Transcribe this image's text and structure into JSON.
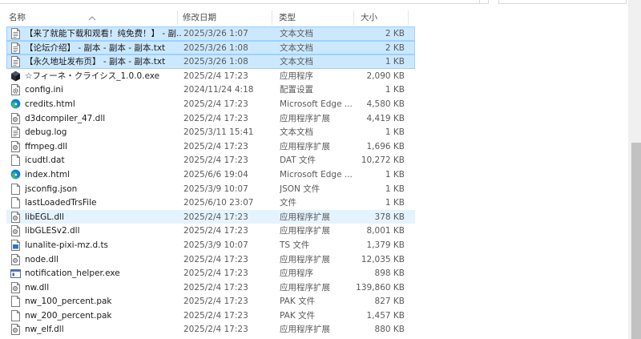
{
  "columns": {
    "name": "名称",
    "date": "修改日期",
    "type": "类型",
    "size": "大小"
  },
  "files": [
    {
      "name": "【来了就能下载和观看！纯免费！】 - 副...",
      "date": "2025/3/26 1:07",
      "type": "文本文档",
      "size": "2 KB",
      "icon": "text-file-icon",
      "state": "selected"
    },
    {
      "name": "【论坛介绍】 - 副本 - 副本 - 副本.txt",
      "date": "2025/3/26 1:08",
      "type": "文本文档",
      "size": "2 KB",
      "icon": "text-file-icon",
      "state": "selected"
    },
    {
      "name": "【永久地址发布页】 - 副本 - 副本.txt",
      "date": "2025/3/26 1:08",
      "type": "文本文档",
      "size": "1 KB",
      "icon": "text-file-icon",
      "state": "selected"
    },
    {
      "name": "☆フィーネ・クライシス_1.0.0.exe",
      "date": "2025/2/4 17:23",
      "type": "应用程序",
      "size": "2,090 KB",
      "icon": "app-exe-icon",
      "state": ""
    },
    {
      "name": "config.ini",
      "date": "2024/11/24 4:18",
      "type": "配置设置",
      "size": "1 KB",
      "icon": "config-file-icon",
      "state": ""
    },
    {
      "name": "credits.html",
      "date": "2025/2/4 17:23",
      "type": "Microsoft Edge ...",
      "size": "4,580 KB",
      "icon": "edge-html-icon",
      "state": ""
    },
    {
      "name": "d3dcompiler_47.dll",
      "date": "2025/2/4 17:23",
      "type": "应用程序扩展",
      "size": "4,419 KB",
      "icon": "dll-file-icon",
      "state": ""
    },
    {
      "name": "debug.log",
      "date": "2025/3/11 15:41",
      "type": "文本文档",
      "size": "1 KB",
      "icon": "text-file-icon",
      "state": ""
    },
    {
      "name": "ffmpeg.dll",
      "date": "2025/2/4 17:23",
      "type": "应用程序扩展",
      "size": "1,696 KB",
      "icon": "dll-file-icon",
      "state": ""
    },
    {
      "name": "icudtl.dat",
      "date": "2025/2/4 17:23",
      "type": "DAT 文件",
      "size": "10,272 KB",
      "icon": "blank-file-icon",
      "state": ""
    },
    {
      "name": "index.html",
      "date": "2025/6/6 19:04",
      "type": "Microsoft Edge ...",
      "size": "1 KB",
      "icon": "edge-html-icon",
      "state": ""
    },
    {
      "name": "jsconfig.json",
      "date": "2025/3/9 10:07",
      "type": "JSON 文件",
      "size": "1 KB",
      "icon": "blank-file-icon",
      "state": ""
    },
    {
      "name": "lastLoadedTrsFile",
      "date": "2025/6/10 23:07",
      "type": "文件",
      "size": "1 KB",
      "icon": "blank-file-icon",
      "state": ""
    },
    {
      "name": "libEGL.dll",
      "date": "2025/2/4 17:23",
      "type": "应用程序扩展",
      "size": "378 KB",
      "icon": "dll-file-icon",
      "state": "hover"
    },
    {
      "name": "libGLESv2.dll",
      "date": "2025/2/4 17:23",
      "type": "应用程序扩展",
      "size": "8,001 KB",
      "icon": "dll-file-icon",
      "state": ""
    },
    {
      "name": "lunalite-pixi-mz.d.ts",
      "date": "2025/3/9 10:07",
      "type": "TS 文件",
      "size": "1,379 KB",
      "icon": "ts-file-icon",
      "state": ""
    },
    {
      "name": "node.dll",
      "date": "2025/2/4 17:23",
      "type": "应用程序扩展",
      "size": "12,035 KB",
      "icon": "dll-file-icon",
      "state": ""
    },
    {
      "name": "notification_helper.exe",
      "date": "2025/2/4 17:23",
      "type": "应用程序",
      "size": "898 KB",
      "icon": "window-app-icon",
      "state": ""
    },
    {
      "name": "nw.dll",
      "date": "2025/2/4 17:23",
      "type": "应用程序扩展",
      "size": "139,860 KB",
      "icon": "dll-file-icon",
      "state": ""
    },
    {
      "name": "nw_100_percent.pak",
      "date": "2025/2/4 17:23",
      "type": "PAK 文件",
      "size": "827 KB",
      "icon": "blank-file-icon",
      "state": ""
    },
    {
      "name": "nw_200_percent.pak",
      "date": "2025/2/4 17:23",
      "type": "PAK 文件",
      "size": "1,457 KB",
      "icon": "blank-file-icon",
      "state": ""
    },
    {
      "name": "nw_elf.dll",
      "date": "2025/2/4 17:23",
      "type": "应用程序扩展",
      "size": "880 KB",
      "icon": "dll-file-icon",
      "state": ""
    }
  ],
  "colors": {
    "selected_bg": "#cce8ff",
    "selected_border": "#99d1ff",
    "hover_bg": "#e5f3ff",
    "edge_blue": "#0f7fd6",
    "edge_green": "#2fc072"
  }
}
